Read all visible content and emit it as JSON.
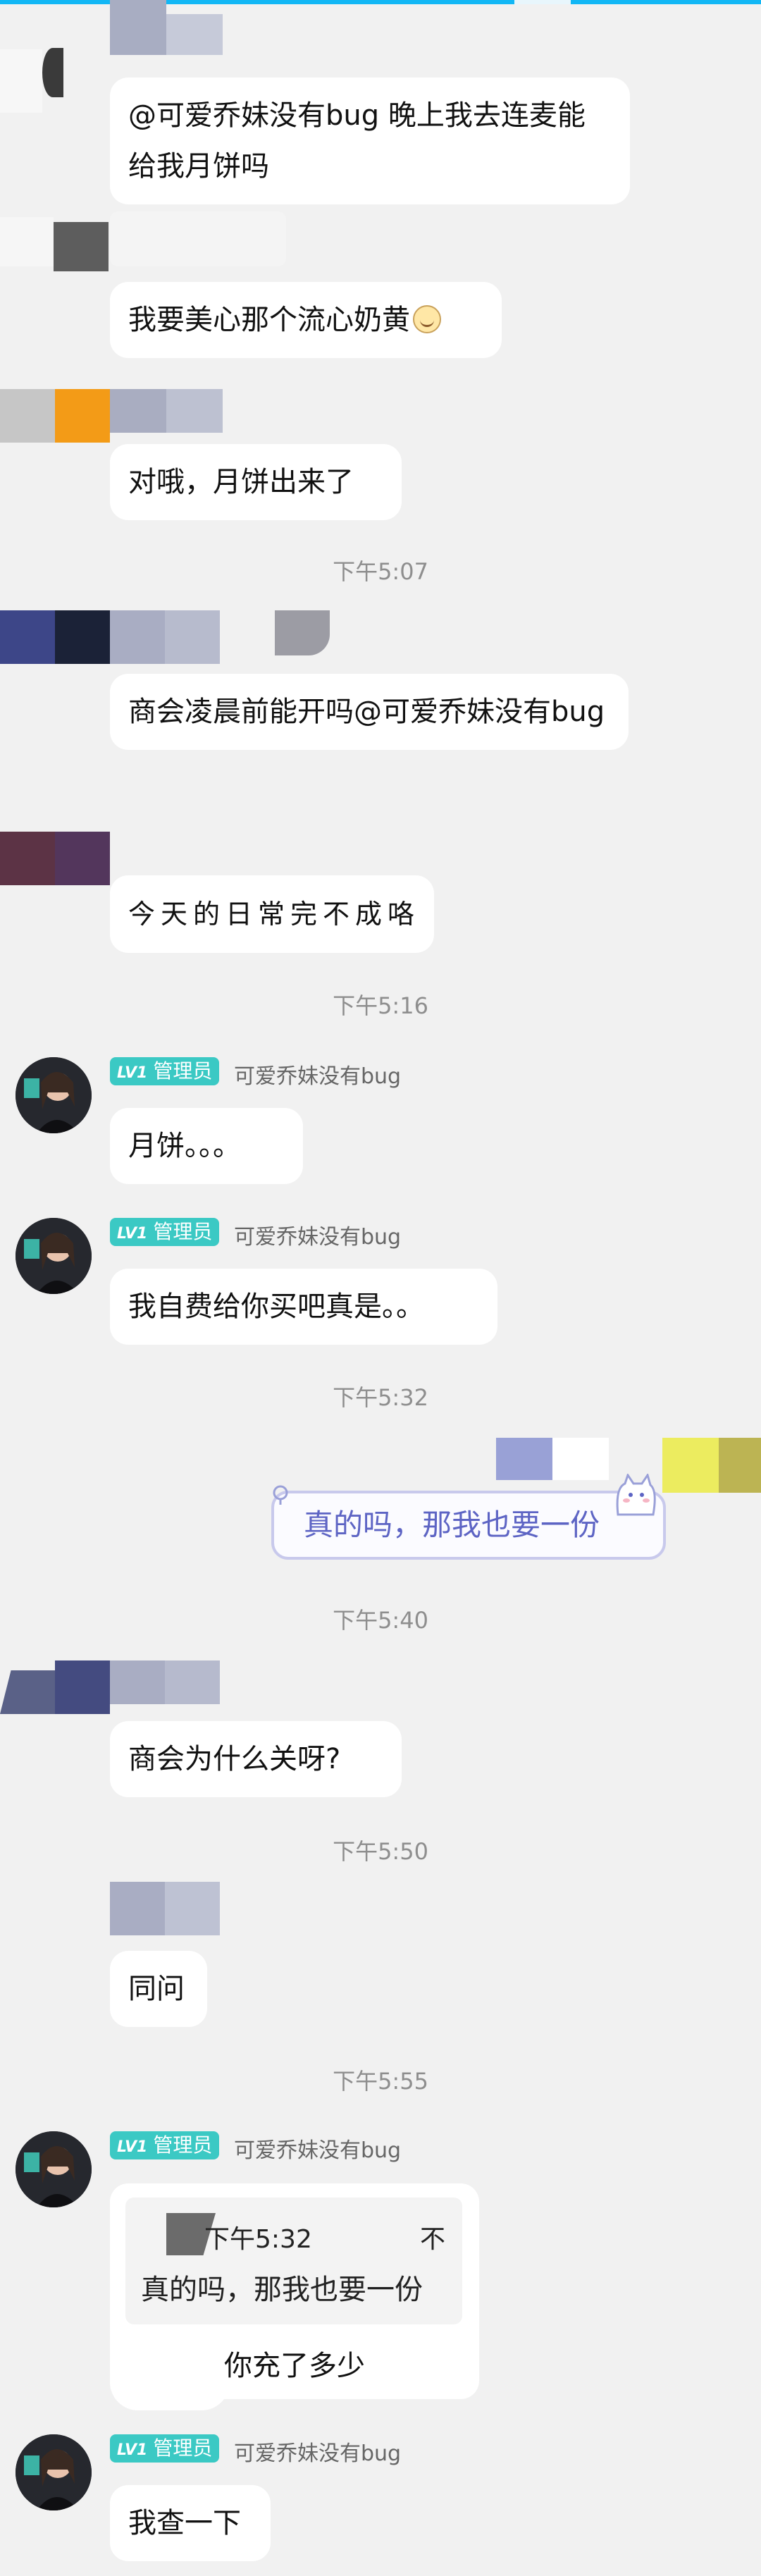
{
  "top_bar": {
    "accent_color": "#12b7f5"
  },
  "messages": [
    {
      "text": "@可爱乔妹没有bug 晚上我去连麦能给我月饼吗"
    },
    {
      "text": "我要美心那个流心奶黄",
      "emoji": "smiling-face-icon"
    },
    {
      "text": "对哦，月饼出来了"
    },
    {
      "time": "下午5:07"
    },
    {
      "text": "商会凌晨前能开吗@可爱乔妹没有bug"
    },
    {
      "text": "今天的日常完不成咯"
    },
    {
      "time": "下午5:16"
    },
    {
      "badge_level": "LV1",
      "badge_role": "管理员",
      "nickname": "可爱乔妹没有bug",
      "text": "月饼。。。"
    },
    {
      "badge_level": "LV1",
      "badge_role": "管理员",
      "nickname": "可爱乔妹没有bug",
      "text": "我自费给你买吧真是。。"
    },
    {
      "time": "下午5:32"
    },
    {
      "text": "真的吗，那我也要一份"
    },
    {
      "time": "下午5:40"
    },
    {
      "text": "商会为什么关呀?"
    },
    {
      "time": "下午5:50"
    },
    {
      "text": "同问"
    },
    {
      "time": "下午5:55"
    },
    {
      "badge_level": "LV1",
      "badge_role": "管理员",
      "nickname": "可爱乔妹没有bug",
      "quote_time": "下午5:32",
      "quote_text": "真的吗，那我也要一份",
      "quote_more": "不",
      "text": "你充了多少"
    },
    {
      "badge_level": "LV1",
      "badge_role": "管理员",
      "nickname": "可爱乔妹没有bug",
      "text": "我查一下"
    }
  ]
}
